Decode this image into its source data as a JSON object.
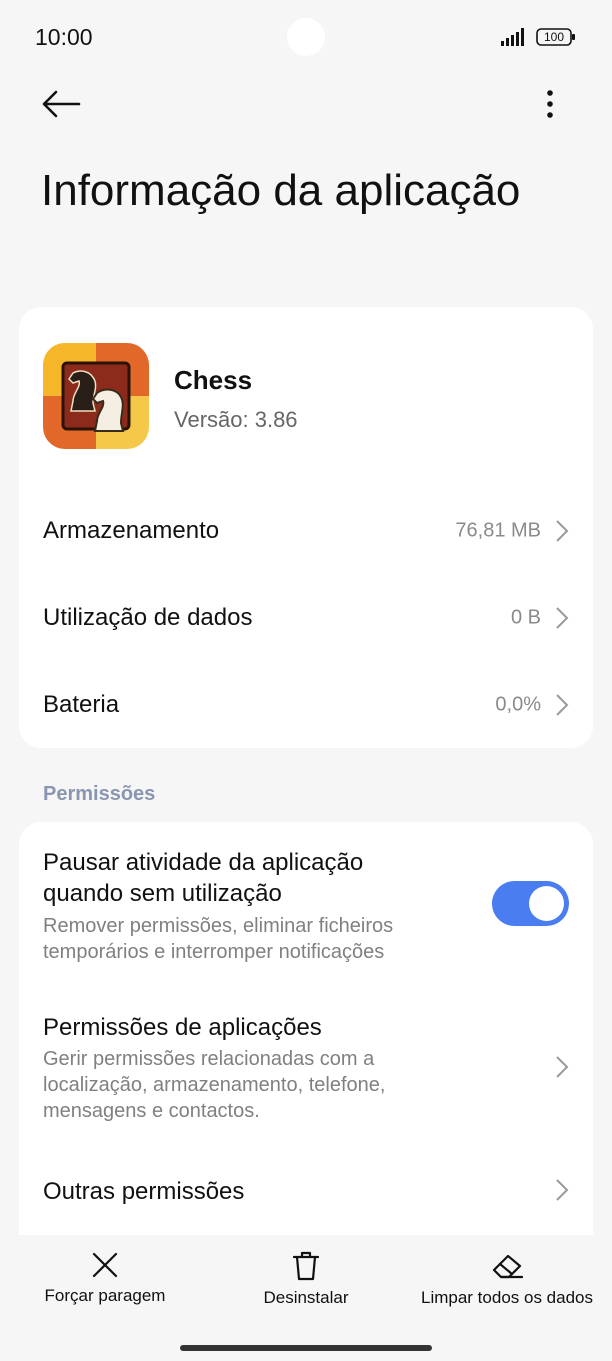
{
  "status": {
    "time": "10:00",
    "battery": "100"
  },
  "header": {
    "title": "Informação da aplicação",
    "back_icon": "arrow-left-icon",
    "more_icon": "more-vertical-icon"
  },
  "app": {
    "name": "Chess",
    "version": "Versão: 3.86",
    "icon": "chess-knight-icon"
  },
  "info_rows": [
    {
      "label": "Armazenamento",
      "value": "76,81 MB"
    },
    {
      "label": "Utilização de dados",
      "value": "0 B"
    },
    {
      "label": "Bateria",
      "value": "0,0%"
    }
  ],
  "permissions": {
    "section_title": "Permissões",
    "pause": {
      "title": "Pausar atividade da aplicação quando sem utilização",
      "description": "Remover permissões, eliminar ficheiros temporários e interromper notificações",
      "enabled": true
    },
    "app_permissions": {
      "title": "Permissões de aplicações",
      "description": "Gerir permissões relacionadas com a localização, armazenamento, telefone, mensagens e contactos."
    },
    "other": {
      "title": "Outras permissões"
    }
  },
  "actions": {
    "force_stop": "Forçar paragem",
    "uninstall": "Desinstalar",
    "clear_data": "Limpar todos os dados"
  },
  "colors": {
    "accent": "#4a7ef0",
    "section": "#8a96b0",
    "background": "#f6f6f6"
  }
}
